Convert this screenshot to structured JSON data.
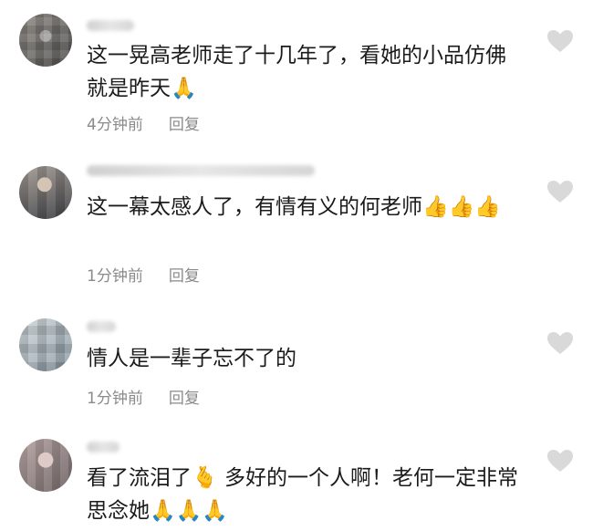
{
  "comments": [
    {
      "text": "这一晃高老师走了十几年了，看她的小品仿佛就是昨天",
      "emoji": "🙏",
      "time": "4分钟前",
      "reply": "回复"
    },
    {
      "text": "这一幕太感人了，有情有义的何老师",
      "emoji": "👍👍👍",
      "time": "1分钟前",
      "reply": "回复"
    },
    {
      "text": "情人是一辈子忘不了的",
      "emoji": "",
      "time": "1分钟前",
      "reply": "回复"
    },
    {
      "text_part1": "看了流泪了",
      "emoji_mid": "🫰",
      "text_part2": "多好的一个人啊！老何一定非常思念她",
      "emoji": "🙏🙏🙏",
      "time": "",
      "reply": ""
    }
  ],
  "icons": {
    "like": "heart-outline-icon",
    "avatar": "blurred-avatar"
  },
  "colors": {
    "text": "#1b1b1b",
    "meta": "#8a8a8a",
    "heart": "#cfcfcf"
  }
}
